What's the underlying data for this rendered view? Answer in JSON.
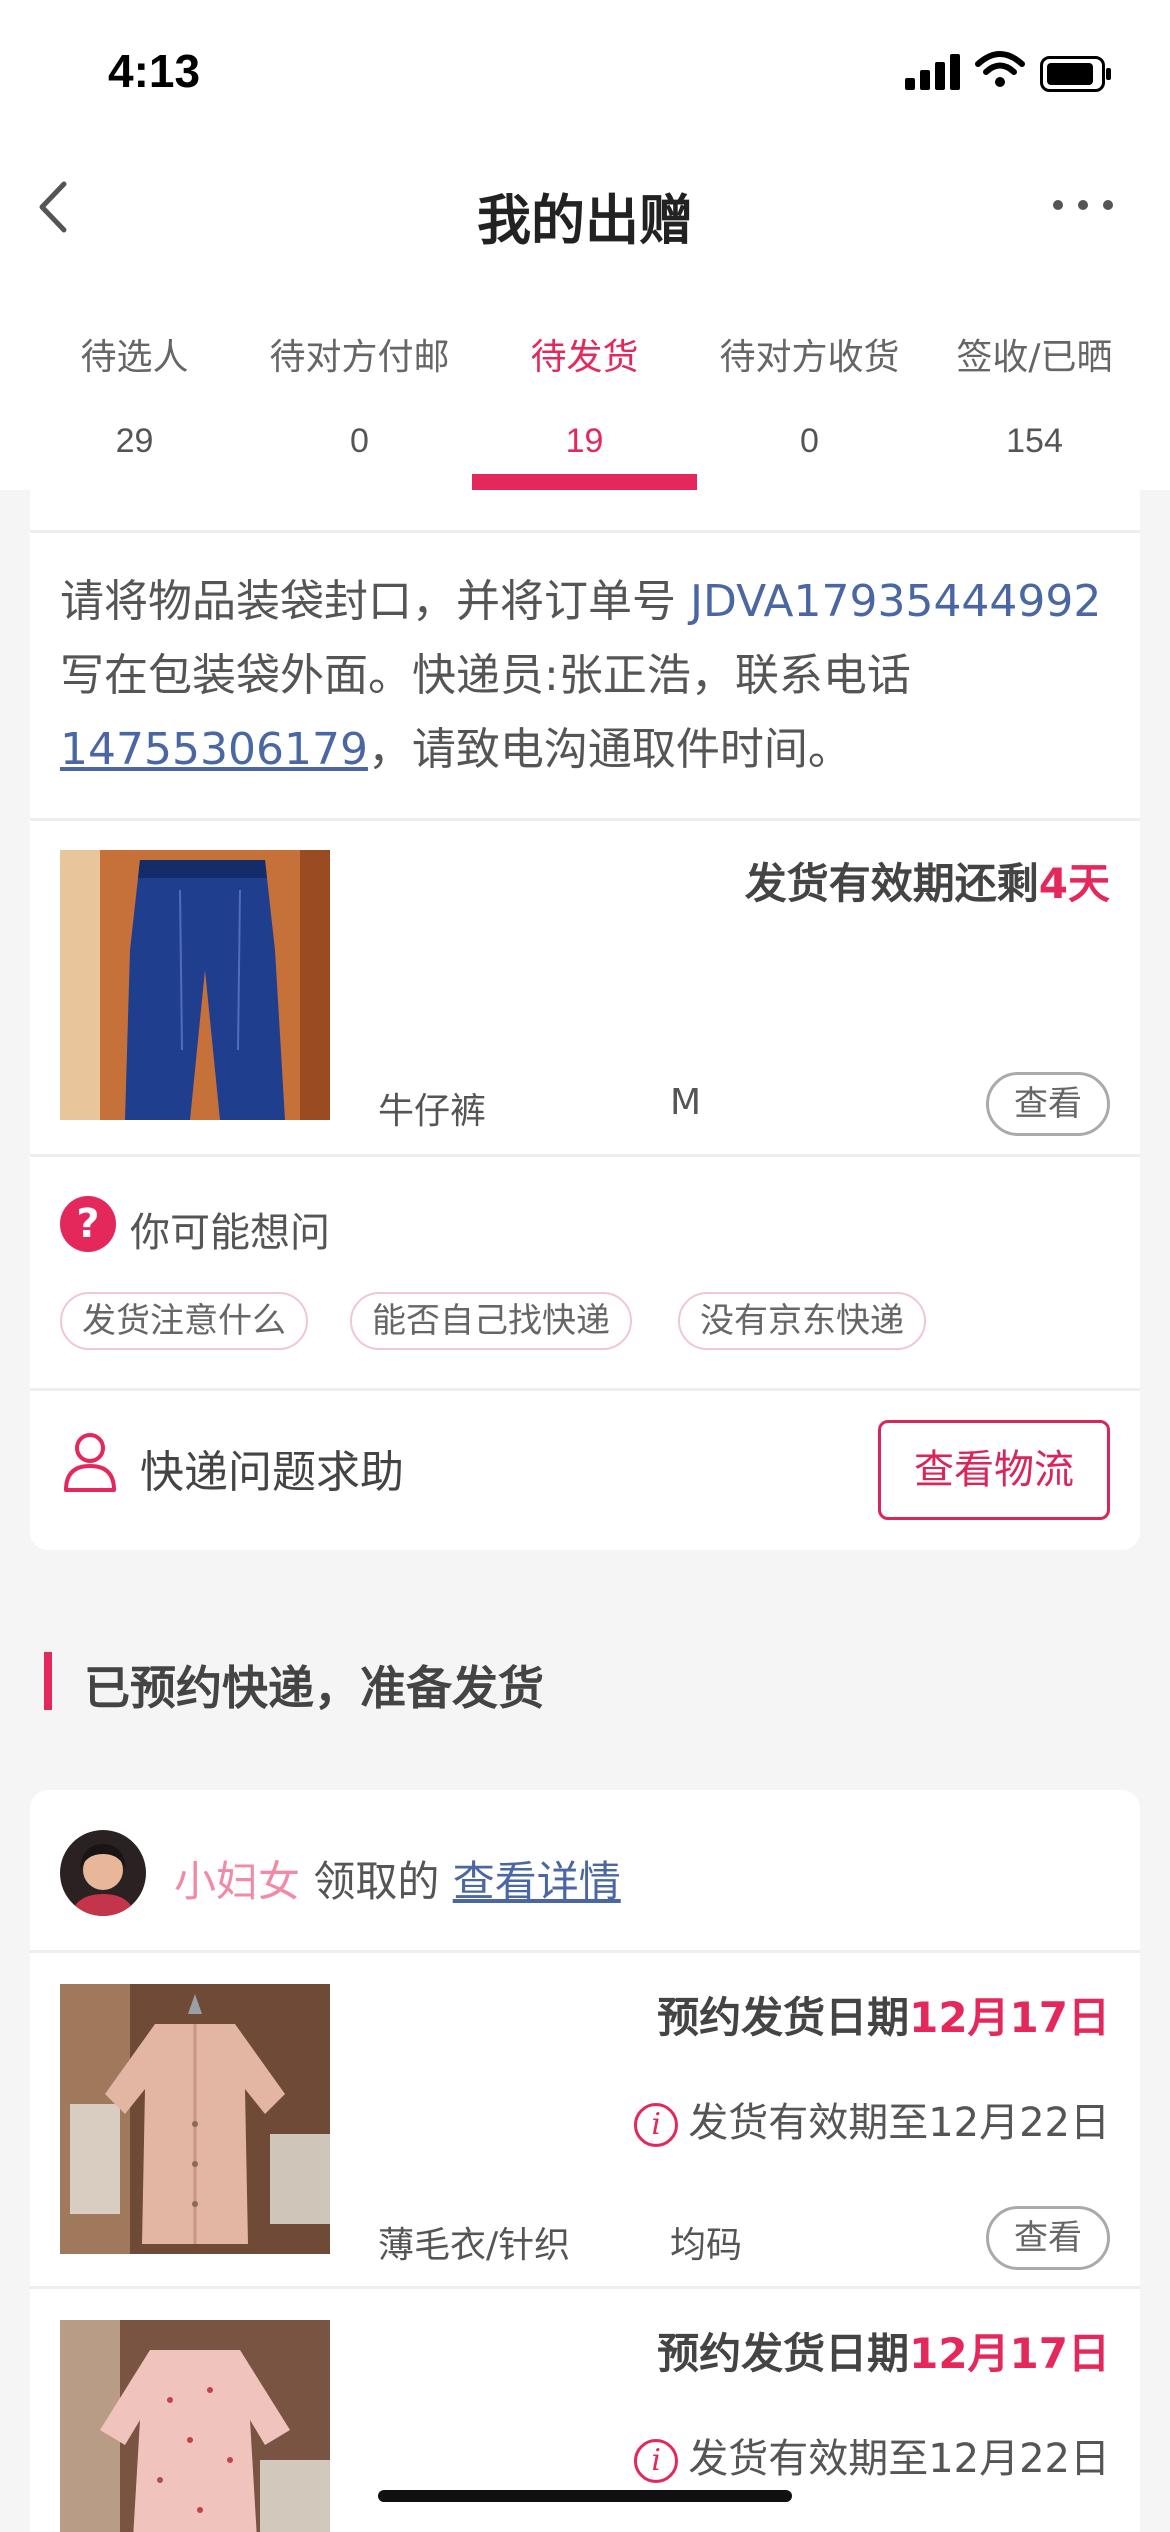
{
  "status_bar": {
    "time": "4:13"
  },
  "nav": {
    "title": "我的出赠"
  },
  "tabs": [
    {
      "label": "待选人",
      "count": "29"
    },
    {
      "label": "待对方付邮",
      "count": "0"
    },
    {
      "label": "待发货",
      "count": "19",
      "active": true
    },
    {
      "label": "待对方收货",
      "count": "0"
    },
    {
      "label": "签收/已晒",
      "count": "154"
    }
  ],
  "order1": {
    "notice_part1": "请将物品装袋封口，并将订单号 ",
    "order_no": "JDVA17935444992",
    "notice_part2": " 写在包装袋外面。快递员:张正浩，联系电话",
    "phone": "14755306179",
    "notice_part3": "，请致电沟通取件时间。",
    "deadline_prefix": "发货有效期还剩",
    "deadline_value": "4天",
    "product_name": "牛仔裤",
    "product_size": "M",
    "view_label": "查看"
  },
  "faq": {
    "title": "你可能想问",
    "icon": "question-icon",
    "chips": [
      "发货注意什么",
      "能否自己找快递",
      "没有京东快递"
    ]
  },
  "help": {
    "label": "快递问题求助",
    "icon": "person-icon",
    "track_label": "查看物流"
  },
  "section": {
    "title": "已预约快递，准备发货"
  },
  "order2": {
    "receiver": "小妇女",
    "received_text": " 领取的 ",
    "detail_link": "查看详情",
    "items": [
      {
        "appt_prefix": "预约发货日期",
        "appt_date": "12月17日",
        "valid_text": "发货有效期至12月22日",
        "name": "薄毛衣/针织",
        "size": "均码",
        "view_label": "查看"
      },
      {
        "appt_prefix": "预约发货日期",
        "appt_date": "12月17日",
        "valid_text": "发货有效期至12月22日"
      }
    ]
  },
  "colors": {
    "accent": "#e5285c",
    "link": "#4a67a3",
    "background": "#f5f5f5"
  }
}
